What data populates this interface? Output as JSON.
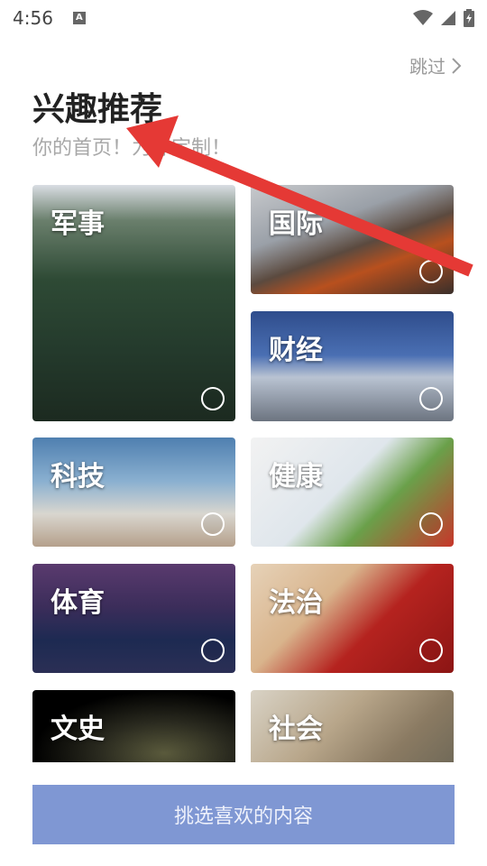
{
  "status_bar": {
    "time": "4:56",
    "notification_letter": "A",
    "icons": [
      "wifi-icon",
      "signal-icon",
      "battery-icon"
    ]
  },
  "header": {
    "skip_label": "跳过",
    "title": "兴趣推荐",
    "subtitle": "你的首页！为你定制！"
  },
  "categories": [
    {
      "label": "军事",
      "selected": false
    },
    {
      "label": "国际",
      "selected": false
    },
    {
      "label": "财经",
      "selected": false
    },
    {
      "label": "科技",
      "selected": false
    },
    {
      "label": "健康",
      "selected": false
    },
    {
      "label": "体育",
      "selected": false
    },
    {
      "label": "法治",
      "selected": false
    },
    {
      "label": "文史",
      "selected": false
    },
    {
      "label": "社会",
      "selected": false
    }
  ],
  "footer": {
    "button_label": "挑选喜欢的内容"
  },
  "colors": {
    "button_bg": "#7f97d3",
    "arrow": "#e53935"
  }
}
